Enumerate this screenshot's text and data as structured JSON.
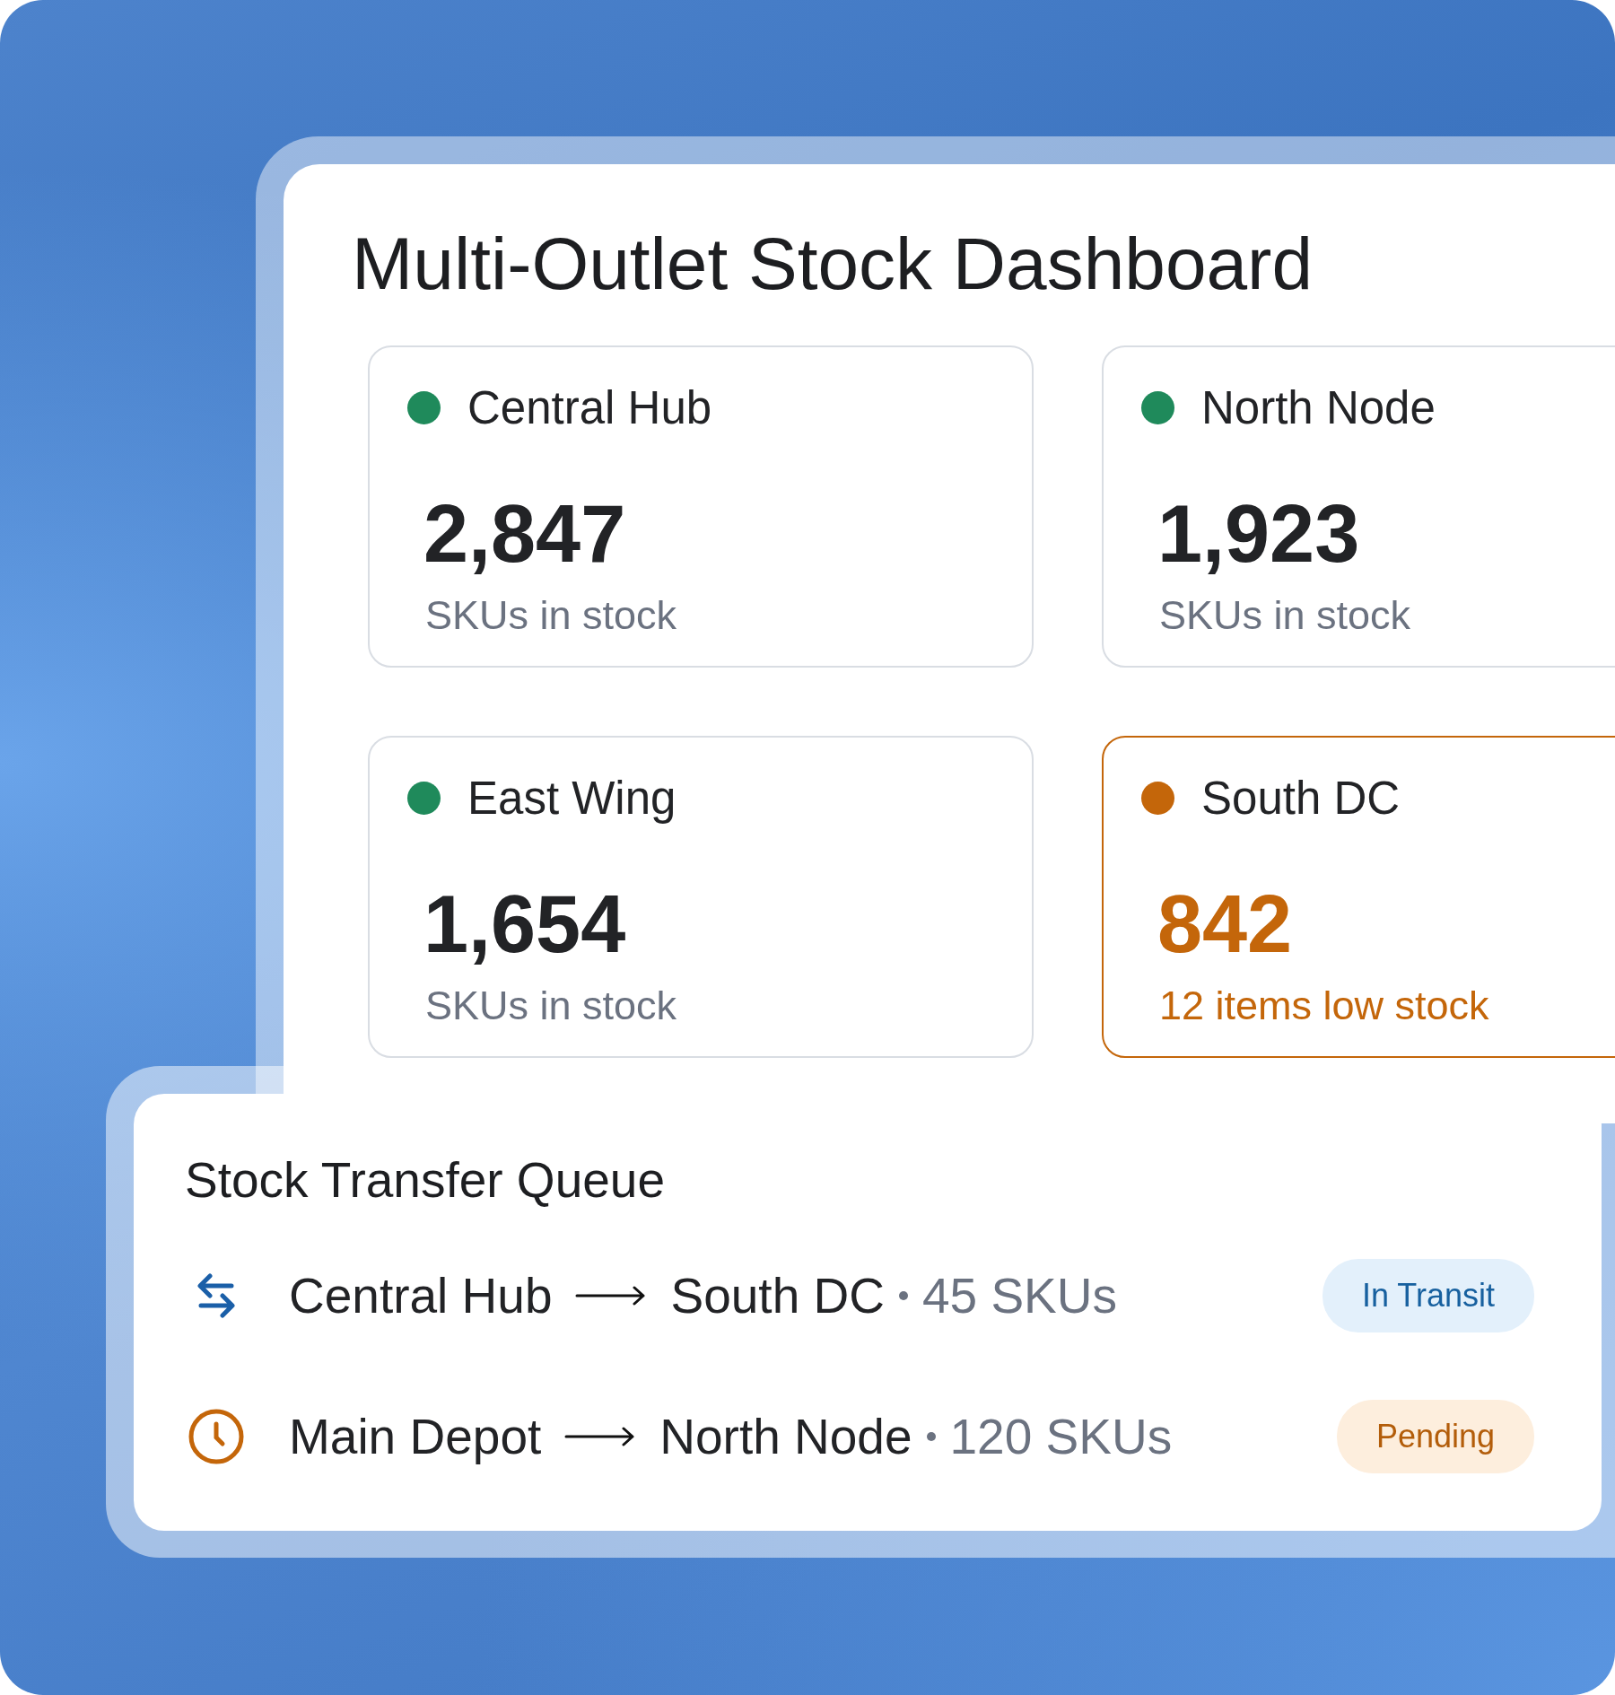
{
  "dashboard": {
    "title": "Multi-Outlet Stock Dashboard",
    "outlets": [
      {
        "name": "Central Hub",
        "color": "#1f8a5b",
        "kind": "normal",
        "count": "2,847",
        "caption": "SKUs in stock"
      },
      {
        "name": "North Node",
        "color": "#1f8a5b",
        "kind": "normal",
        "count": "1,923",
        "caption": "SKUs in stock"
      },
      {
        "name": "East Wing",
        "color": "#1f8a5b",
        "kind": "normal",
        "count": "1,654",
        "caption": "SKUs in stock"
      },
      {
        "name": "South DC",
        "color": "#c4660a",
        "kind": "low",
        "count": "842",
        "caption": "12 items low stock"
      }
    ]
  },
  "transfer_queue": {
    "title": "Stock Transfer Queue",
    "transfers": [
      {
        "kind": "transit",
        "from": "Central Hub",
        "to": "South DC",
        "quantity": "45 SKUs",
        "status": "In Transit"
      },
      {
        "kind": "pending",
        "from": "Main Depot",
        "to": "North Node",
        "quantity": "120 SKUs",
        "status": "Pending"
      }
    ]
  }
}
